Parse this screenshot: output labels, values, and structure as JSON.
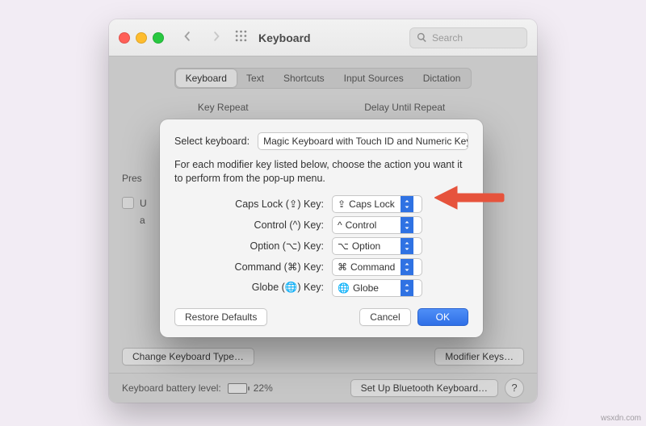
{
  "window": {
    "title": "Keyboard",
    "search_placeholder": "Search"
  },
  "tabs": [
    "Keyboard",
    "Text",
    "Shortcuts",
    "Input Sources",
    "Dictation"
  ],
  "labels": {
    "key_repeat": "Key Repeat",
    "delay_repeat": "Delay Until Repeat",
    "press_trunc": "Pres",
    "u_line": "U",
    "a_line": "a"
  },
  "buttons": {
    "change_type": "Change Keyboard Type…",
    "modifier_keys": "Modifier Keys…",
    "setup_bt": "Set Up Bluetooth Keyboard…"
  },
  "footer": {
    "battery_label": "Keyboard battery level:",
    "battery_pct": "22%"
  },
  "sheet": {
    "select_label": "Select keyboard:",
    "keyboard_name": "Magic Keyboard with Touch ID and Numeric Keypad",
    "desc": "For each modifier key listed below, choose the action you want it to perform from the pop-up menu.",
    "rows": [
      {
        "label": "Caps Lock (⇪) Key:",
        "glyph": "⇪",
        "value": "Caps Lock"
      },
      {
        "label": "Control (^) Key:",
        "glyph": "^",
        "value": "Control"
      },
      {
        "label": "Option (⌥) Key:",
        "glyph": "⌥",
        "value": "Option"
      },
      {
        "label": "Command (⌘) Key:",
        "glyph": "⌘",
        "value": "Command"
      },
      {
        "label": "Globe (🌐) Key:",
        "glyph": "🌐",
        "value": "Globe"
      }
    ],
    "restore": "Restore Defaults",
    "cancel": "Cancel",
    "ok": "OK"
  },
  "watermark": "wsxdn.com"
}
